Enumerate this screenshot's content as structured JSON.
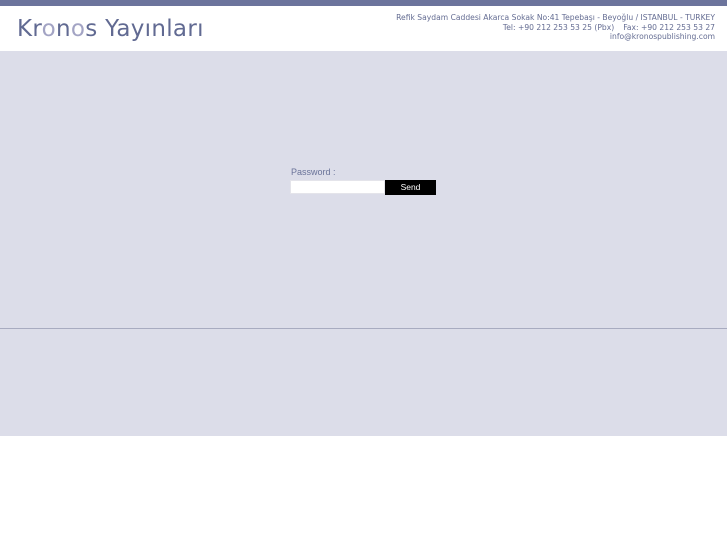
{
  "header": {
    "logo_part1": "Kr",
    "logo_part2": "o",
    "logo_part3": "n",
    "logo_part4": "o",
    "logo_part5": "s Yayınları",
    "address": "Refik Saydam Caddesi Akarca Sokak No:41 Tepebaşı - Beyoğlu / ISTANBUL - TURKEY",
    "tel": "Tel: +90 212 253 53 25 (Pbx)",
    "fax": "Fax: +90 212 253 53 27",
    "email": "info@kronospublishing.com"
  },
  "login": {
    "label": "Password :",
    "value": "",
    "send_label": "Send"
  },
  "colors": {
    "top_bar": "#6c749c",
    "background_panel": "#dcdde9",
    "text": "#646c92",
    "button": "#000000"
  }
}
